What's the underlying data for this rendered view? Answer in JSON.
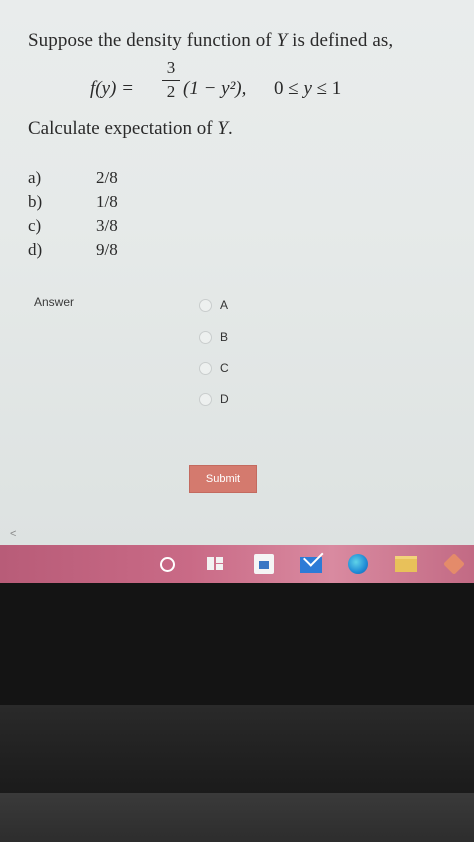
{
  "question": {
    "line1_prefix": "Suppose the density function of ",
    "line1_var": "Y",
    "line1_suffix": " is defined as,",
    "formula_lhs": "f(y) =",
    "formula_frac_num": "3",
    "formula_frac_den": "2",
    "formula_rhs": "(1 − y²),",
    "formula_domain_prefix": "0 ≤ ",
    "formula_domain_var": "y",
    "formula_domain_suffix": " ≤ 1",
    "line3_prefix": "Calculate expectation of ",
    "line3_var": "Y",
    "line3_suffix": "."
  },
  "options": [
    {
      "letter": "a)",
      "value": "2/8"
    },
    {
      "letter": "b)",
      "value": "1/8"
    },
    {
      "letter": "c)",
      "value": "3/8"
    },
    {
      "letter": "d)",
      "value": "9/8"
    }
  ],
  "answer": {
    "label": "Answer",
    "choices": [
      "A",
      "B",
      "C",
      "D"
    ]
  },
  "submit_label": "Submit",
  "back_glyph": "<",
  "taskbar": {
    "icons": [
      "search-icon",
      "task-view-icon",
      "store-icon",
      "mail-icon",
      "edge-icon",
      "file-explorer-icon",
      "photos-icon"
    ]
  }
}
